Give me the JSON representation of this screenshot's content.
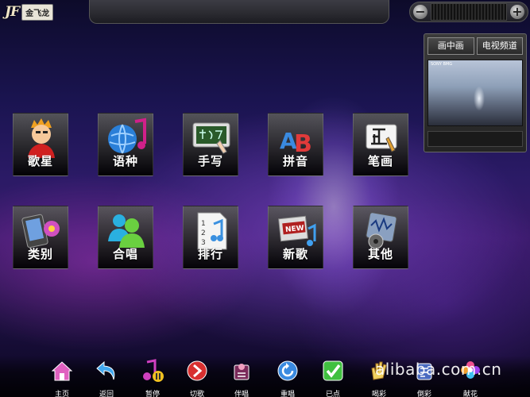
{
  "header": {
    "logo_mark": "JF",
    "brand_name": "金飞龙",
    "volume_minus": "−",
    "volume_plus": "+"
  },
  "preview": {
    "tabs": [
      "画中画",
      "电视频道"
    ],
    "video_tag": "SONY BMG"
  },
  "menu": {
    "row1": [
      {
        "label": "歌星",
        "icon": "singer-icon"
      },
      {
        "label": "语种",
        "icon": "language-icon"
      },
      {
        "label": "手写",
        "icon": "handwriting-icon"
      },
      {
        "label": "拼音",
        "icon": "pinyin-icon"
      },
      {
        "label": "笔画",
        "icon": "strokes-icon"
      }
    ],
    "row2": [
      {
        "label": "类别",
        "icon": "category-icon"
      },
      {
        "label": "合唱",
        "icon": "duet-icon"
      },
      {
        "label": "排行",
        "icon": "ranking-icon"
      },
      {
        "label": "新歌",
        "icon": "new-songs-icon"
      },
      {
        "label": "其他",
        "icon": "other-icon"
      }
    ]
  },
  "toolbar": {
    "items": [
      {
        "label": "主页",
        "icon": "home-icon"
      },
      {
        "label": "返回",
        "icon": "back-icon"
      },
      {
        "label": "暂停",
        "icon": "pause-icon"
      },
      {
        "label": "切歌",
        "icon": "skip-icon"
      },
      {
        "label": "伴唱",
        "icon": "accompany-icon"
      },
      {
        "label": "重唱",
        "icon": "replay-icon"
      },
      {
        "label": "已点",
        "icon": "selected-icon"
      },
      {
        "label": "喝彩",
        "icon": "cheer-icon"
      },
      {
        "label": "倒彩",
        "icon": "boo-icon"
      },
      {
        "label": "献花",
        "icon": "flower-icon"
      }
    ]
  },
  "watermark": "alibaba.com.cn",
  "colors": {
    "background_top": "#0d0b2a",
    "background_mid": "#3a1a6a",
    "tile_label": "#ffffff"
  }
}
